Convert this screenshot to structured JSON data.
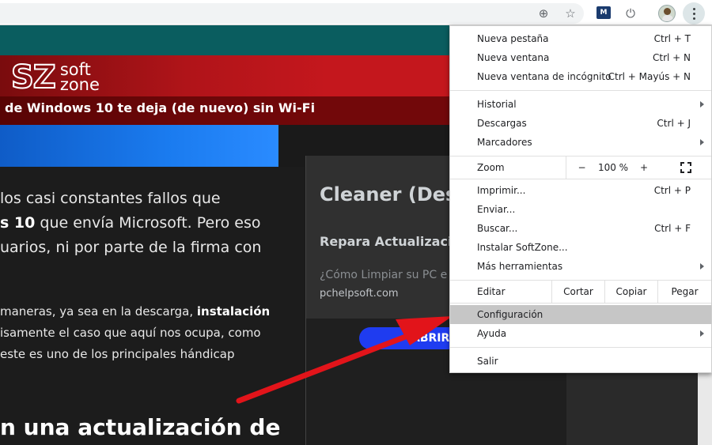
{
  "page": {
    "logo_mark": "SZ",
    "logo_word1": "soft",
    "logo_word2": "zone",
    "headline": "de Windows 10 te deja (de nuevo) sin Wi-Fi",
    "para1": {
      "line1": "los casi constantes fallos que",
      "line2_bold": "s 10",
      "line2_rest": " que envía Microsoft. Pero eso",
      "line3": "uarios, ni por parte de la firma con"
    },
    "para2": {
      "line1_rest": "maneras, ya sea en la descarga, ",
      "line1_bold": "instalación",
      "line2": "isamente el caso que aquí nos ocupa, como",
      "line3": " este es uno de los principales hándicap"
    },
    "big_title": "n una actualización de"
  },
  "ad": {
    "title": "Cleaner (Des",
    "subtitle": "Repara Actualizació",
    "description": "¿Cómo Limpiar su PC e",
    "url": "pchelpsoft.com",
    "button": "ABRIR"
  },
  "menu": {
    "items": [
      {
        "label": "Nueva pestaña",
        "shortcut": "Ctrl + T"
      },
      {
        "label": "Nueva ventana",
        "shortcut": "Ctrl + N"
      },
      {
        "label": "Nueva ventana de incógnito",
        "shortcut": "Ctrl + Mayús + N"
      },
      {
        "label": "Historial",
        "shortcut": ""
      },
      {
        "label": "Descargas",
        "shortcut": "Ctrl + J"
      },
      {
        "label": "Marcadores",
        "shortcut": ""
      },
      {
        "label": "Imprimir...",
        "shortcut": "Ctrl + P"
      },
      {
        "label": "Enviar...",
        "shortcut": ""
      },
      {
        "label": "Buscar...",
        "shortcut": "Ctrl + F"
      },
      {
        "label": "Instalar SoftZone...",
        "shortcut": ""
      },
      {
        "label": "Más herramientas",
        "shortcut": ""
      },
      {
        "label": "Configuración",
        "shortcut": ""
      },
      {
        "label": "Ayuda",
        "shortcut": ""
      },
      {
        "label": "Salir",
        "shortcut": ""
      }
    ],
    "zoom": {
      "label": "Zoom",
      "minus": "−",
      "value": "100 %",
      "plus": "+"
    },
    "edit": {
      "label": "Editar",
      "cut": "Cortar",
      "copy": "Copiar",
      "paste": "Pegar"
    }
  },
  "colors": {
    "teal": "#0a5d5f",
    "brand_red": "#c4171d",
    "highlight": "#c6c6c6",
    "arrow": "#e2141a",
    "ad_button": "#1f3cf0"
  },
  "icons": {
    "add": "plus-circle-icon",
    "bookmark": "star-icon",
    "extension": "extension-m-icon",
    "power": "power-icon",
    "avatar": "profile-avatar",
    "menu": "three-dots-vertical-icon",
    "fullscreen": "fullscreen-icon"
  }
}
